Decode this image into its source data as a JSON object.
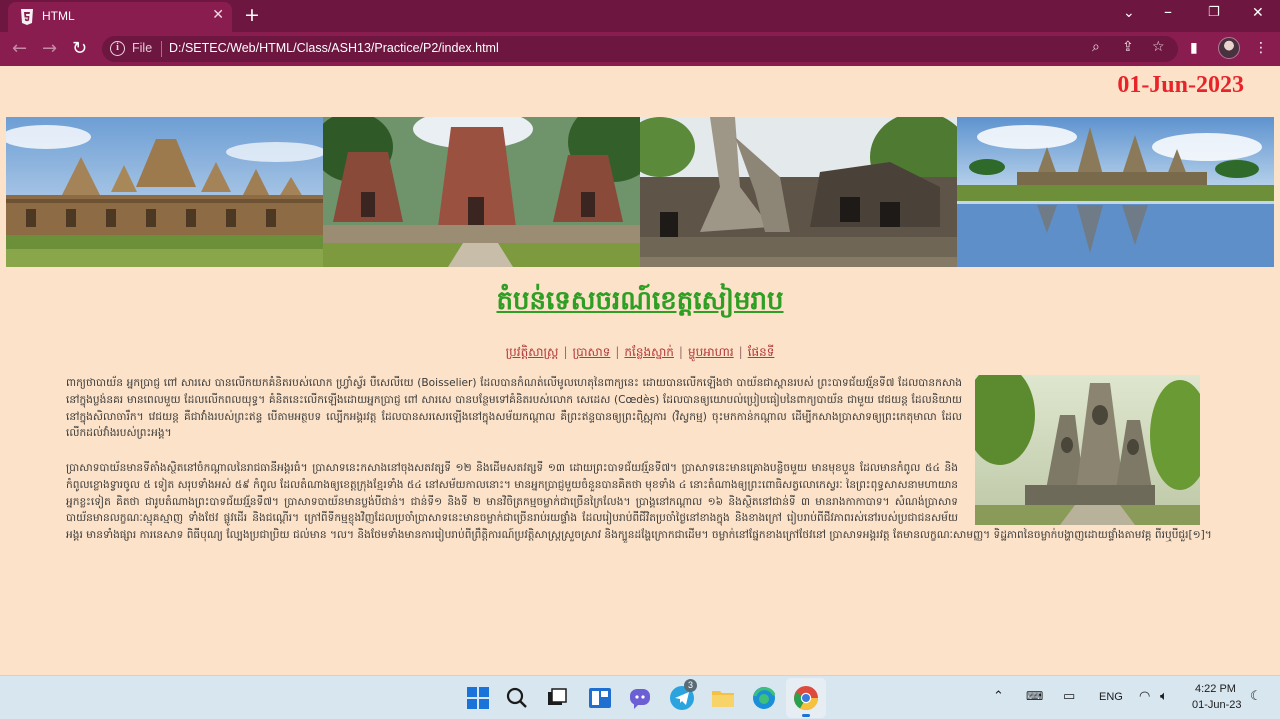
{
  "browser": {
    "tab_title": "HTML",
    "file_label": "File",
    "url": "D:/SETEC/Web/HTML/Class/ASH13/Practice/P2/index.html"
  },
  "page": {
    "date": "01-Jun-2023",
    "title": "តំបន់ទេសចរណ៍ខេត្តសៀមរាប",
    "nav": [
      "ប្រវត្តិសាស្ត្រ",
      "ប្រាសាទ",
      "កន្លែងស្នាក់",
      "ម្ហូបអាហារ",
      "ផែនទី"
    ],
    "paragraph_1": "ពាក្យថាបាយ័ន អ្នកប្រាជ្ញ ពៅ សារសេ បានលើកយកគំនិតរបស់លោក ហ្វ្រាំស្វ័រ បឺសេលីយេ (Boisselier) ដែលបានកំណត់លើមូលហេតុនៃពាក្យនេះ ដោយបានលើកឡើងថា បាយ័នជាស្ពានរបស់ ព្រះបាទជ័យវរ្ម័នទី៧ ដែលបានកសាងនៅក្នុងប្លង់នគរ មានពេលមួយ ដែលលើកពលយុទ្ធ។ គំនិតនេះលើកឡើងដោយអ្នកប្រាជ្ញ ពៅ សារសេ បានបន្ថែមទៅគំនិតរបស់លោក សេដេស (Cœdès) ដែលបានឲ្យយោបល់ប្រៀបធៀបនៃពាក្យបាយ័ន ជាមួយ វេជយន្ត ដែលនិយាយនៅក្នុងសិលាចារឹក។ វេជយន្ត គឺជាវាំងរបស់ព្រះឥន្ទ បើតាមអត្ថបទ ល្បើកអង្គរវត្ត ដែលបានសរសេរឡើងនៅក្នុងសម័យកណ្តាល គឺព្រះឥន្ទបានឲ្យព្រះពិស្ណុការ (វិស្វកម្ម) ចុះមកកាន់កណ្តាល ដើម្បីកសាងប្រាសាទឲ្យព្រះកេតុមាលា ដែលលើកដល់វាំងរបស់ព្រះអង្គ។",
    "paragraph_2": "ប្រាសាទបាយ័នមានទីតាំងស្ថិតនៅចំកណ្តាលនៃរាជធានីអង្គរធំ។ ប្រាសាទនេះកសាងនៅចុងសតវត្សទី ១២ និងដើមសតវត្សទី ១៣ ដោយព្រះបាទជ័យវរ្ម័នទី៧។ ប្រាសាទនេះមានគ្រោងបន្លិចមួយ មានមុខបួន ដែលមានកំពូល ៥៤ និងកំពូលខ្លោងទ្វារចូល ៥ ទៀត សរុបទាំងអស់ ៥៩ កំពូល ដែលតំណាងឲ្យខេត្តក្រុងខ្មែរទាំង ៥៤ នៅសម័យកាលនោះ។ មានអ្នកប្រាជ្ញមួយចំនួនបានគិតថា មុខទាំង ៤ នោះតំណាងឲ្យព្រះពោធិសត្វលោកេស្វរៈ នៃព្រះពុទ្ធសាសនាមហាយាន អ្នកខ្លះទៀត គិតថា ជារូបតំណាងព្រះបាទជ័យវរ្ម័នទី៧។ ប្រាសាទបាយ័នមានប្លង់បីជាន់។ ជាន់ទី១ និងទី ២ មានវិចិត្រកម្មចម្លាក់ជាច្រើនក្រៃលែង។ ប្រាង្គនៅកណ្តាល ១៦ និងស្ថិតនៅជាន់ទី ៣ មានរាងកាកាបាទ។ សំណង់ប្រាសាទបាយ័នមានលក្ខណៈស្មុគស្មាញ ទាំងថែវ ផ្លូវដើរ និងជណ្តើរ។ ក្រៅពីទីកម្មខ្ញុងវិញដែលប្រចាំប្រាសាទនេះមានចម្លាក់ជាច្រើនរាប់រយផ្ទាំង ដែលរៀបរាប់ពីជីវិតប្រចាំថ្ងៃនៅខាងក្នុង និងខាងក្រៅ រៀបរាប់ពីជីវភាពរស់នៅរបស់ប្រជាជនសម័យអង្គរ មានទាំងផ្សារ ការនេសាទ ពិធីបុណ្យ ល្បែងប្រជាប្រិយ ជល់មាន ។ល។ និងថែមទាំងមានការរៀបរាប់ពីព្រឹត្តិការណ៍ប្រវត្តិសាស្ត្រស្រួចស្រាវ និងក្បួនដង្ហែក្រោកជាដើម។ ចម្លាក់នៅផ្នែកខាងក្រៅថែវនៅ ប្រាសាទអង្គរវត្ត តែមានលក្ខណៈសាមញ្ញ។ ទិដ្ឋភាពនៃចម្លាក់បង្ហាញដោយផ្ទាំងតាមវគ្គ ពីរឬបីជួរ[១]។"
  },
  "taskbar": {
    "chat_badge": "3",
    "language": "ENG",
    "time": "4:22 PM",
    "date": "01-Jun-23"
  },
  "colors": {
    "tab_strip": "#6d1640",
    "toolbar": "#8a1d4f",
    "page_bg": "#fbe2c8",
    "title_green": "#2f9e24",
    "date_red": "#e8242a",
    "nav_link": "#b2373a"
  }
}
